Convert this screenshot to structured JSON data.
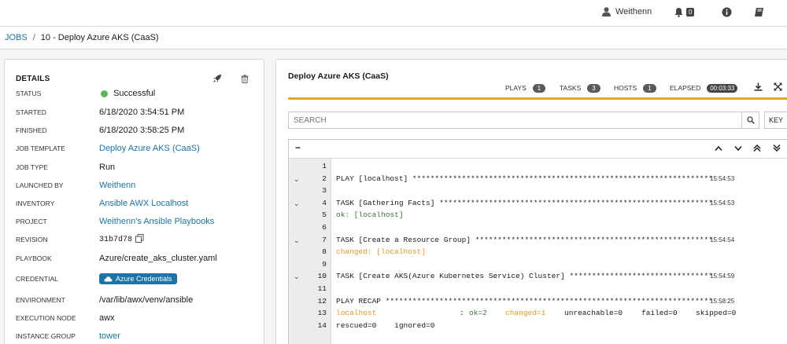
{
  "topbar": {
    "username": "Weithenn",
    "notifications_count": "0"
  },
  "breadcrumb": {
    "jobs": "JOBS",
    "separator": "/",
    "current": "10 - Deploy Azure AKS (CaaS)"
  },
  "details": {
    "title": "DETAILS",
    "rows": [
      {
        "label": "STATUS",
        "value": "Successful"
      },
      {
        "label": "STARTED",
        "value": "6/18/2020 3:54:51 PM"
      },
      {
        "label": "FINISHED",
        "value": "6/18/2020 3:58:25 PM"
      },
      {
        "label": "JOB TEMPLATE",
        "value": "Deploy Azure AKS (CaaS)"
      },
      {
        "label": "JOB TYPE",
        "value": "Run"
      },
      {
        "label": "LAUNCHED BY",
        "value": "Weithenn"
      },
      {
        "label": "INVENTORY",
        "value": "Ansible AWX Localhost"
      },
      {
        "label": "PROJECT",
        "value": "Weithenn's Ansible Playbooks"
      },
      {
        "label": "REVISION",
        "value": "31b7d78"
      },
      {
        "label": "PLAYBOOK",
        "value": "Azure/create_aks_cluster.yaml"
      },
      {
        "label": "CREDENTIAL",
        "value": "Azure Credentials"
      },
      {
        "label": "ENVIRONMENT",
        "value": "/var/lib/awx/venv/ansible"
      },
      {
        "label": "EXECUTION NODE",
        "value": "awx"
      },
      {
        "label": "INSTANCE GROUP",
        "value": "tower"
      }
    ]
  },
  "output": {
    "title": "Deploy Azure AKS (CaaS)",
    "stats": {
      "plays_label": "PLAYS",
      "plays": "1",
      "tasks_label": "TASKS",
      "tasks": "3",
      "hosts_label": "HOSTS",
      "hosts": "1",
      "elapsed_label": "ELAPSED",
      "elapsed": "00:03:33"
    },
    "search_placeholder": "SEARCH",
    "key_label": "KEY",
    "collapse_symbol": "−",
    "lines": [
      {
        "num": "1",
        "text": "",
        "time": "",
        "chevron": ""
      },
      {
        "num": "2",
        "text": "PLAY [localhost] *******************************************************************",
        "time": "15:54:53",
        "chevron": "⌄"
      },
      {
        "num": "3",
        "text": "",
        "time": "",
        "chevron": ""
      },
      {
        "num": "4",
        "text": "TASK [Gathering Facts] *************************************************************",
        "time": "15:54:53",
        "chevron": "⌄"
      },
      {
        "num": "5",
        "text": "ok: [localhost]",
        "time": "",
        "chevron": ""
      },
      {
        "num": "6",
        "text": "",
        "time": "",
        "chevron": ""
      },
      {
        "num": "7",
        "text": "TASK [Create a Resource Group] *****************************************************",
        "time": "15:54:54",
        "chevron": "⌄"
      },
      {
        "num": "8",
        "text": "changed: [localhost]",
        "time": "",
        "chevron": ""
      },
      {
        "num": "9",
        "text": "",
        "time": "",
        "chevron": ""
      },
      {
        "num": "10",
        "text": "TASK [Create AKS(Azure Kubernetes Service) Cluster] ********************************",
        "time": "15:54:59",
        "chevron": "⌄"
      },
      {
        "num": "11",
        "text": "",
        "time": "",
        "chevron": ""
      },
      {
        "num": "12",
        "text": "PLAY RECAP *************************************************************************",
        "time": "15:58:25",
        "chevron": ""
      },
      {
        "num": "13",
        "text": "",
        "time": "",
        "chevron": ""
      },
      {
        "num": "14",
        "text": "rescued=0    ignored=0",
        "time": "",
        "chevron": ""
      }
    ],
    "recap": {
      "host": "localhost",
      "sep": ": ",
      "ok": "ok=2",
      "changed": "changed=1",
      "unreachable": "unreachable=0",
      "failed": "failed=0",
      "skipped": "skipped=0"
    },
    "colors": {
      "ok": "#3c763d",
      "changed": "#e09a25",
      "accent": "#e6a730",
      "link": "#1a73a9"
    }
  }
}
